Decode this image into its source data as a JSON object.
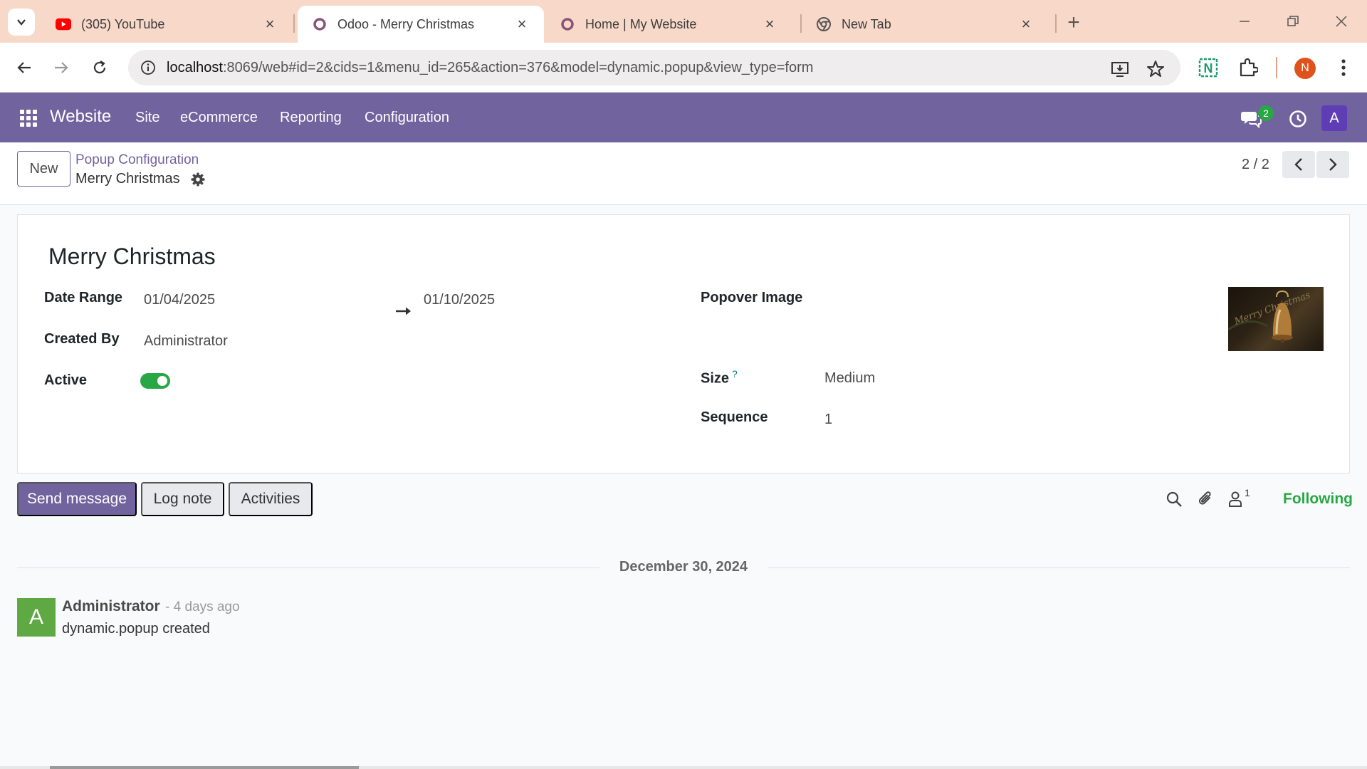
{
  "browser": {
    "tabs": [
      {
        "title": "(305) YouTube",
        "icon": "youtube-icon"
      },
      {
        "title": "Odoo - Merry Christmas",
        "icon": "odoo-icon",
        "active": true
      },
      {
        "title": "Home | My Website",
        "icon": "odoo-icon"
      },
      {
        "title": "New Tab",
        "icon": "chrome-icon"
      }
    ],
    "url_host": "localhost",
    "url_rest": ":8069/web#id=2&cids=1&menu_id=265&action=376&model=dynamic.popup&view_type=form",
    "profile_initial": "N"
  },
  "navbar": {
    "app_name": "Website",
    "menu": [
      "Site",
      "eCommerce",
      "Reporting",
      "Configuration"
    ],
    "messages_count": "2",
    "user_initial": "A"
  },
  "control_panel": {
    "new_label": "New",
    "breadcrumb_parent": "Popup Configuration",
    "breadcrumb_current": "Merry Christmas",
    "pager": "2 / 2"
  },
  "form": {
    "name": "Merry Christmas",
    "date_range_label": "Date Range",
    "date_start": "01/04/2025",
    "date_end": "01/10/2025",
    "created_by_label": "Created By",
    "created_by": "Administrator",
    "active_label": "Active",
    "active": true,
    "popover_image_label": "Popover Image",
    "size_label": "Size",
    "size_help": "?",
    "size": "Medium",
    "sequence_label": "Sequence",
    "sequence": "1"
  },
  "chatter": {
    "send_message": "Send message",
    "log_note": "Log note",
    "activities": "Activities",
    "followers_count": "1",
    "following": "Following",
    "date_separator": "December 30, 2024",
    "messages": [
      {
        "avatar": "A",
        "author": "Administrator",
        "time": "- 4 days ago",
        "body": "dynamic.popup created"
      }
    ]
  },
  "colors": {
    "odoo_purple": "#71639e",
    "success_green": "#28a745",
    "tabstrip": "#f8d9c9"
  }
}
